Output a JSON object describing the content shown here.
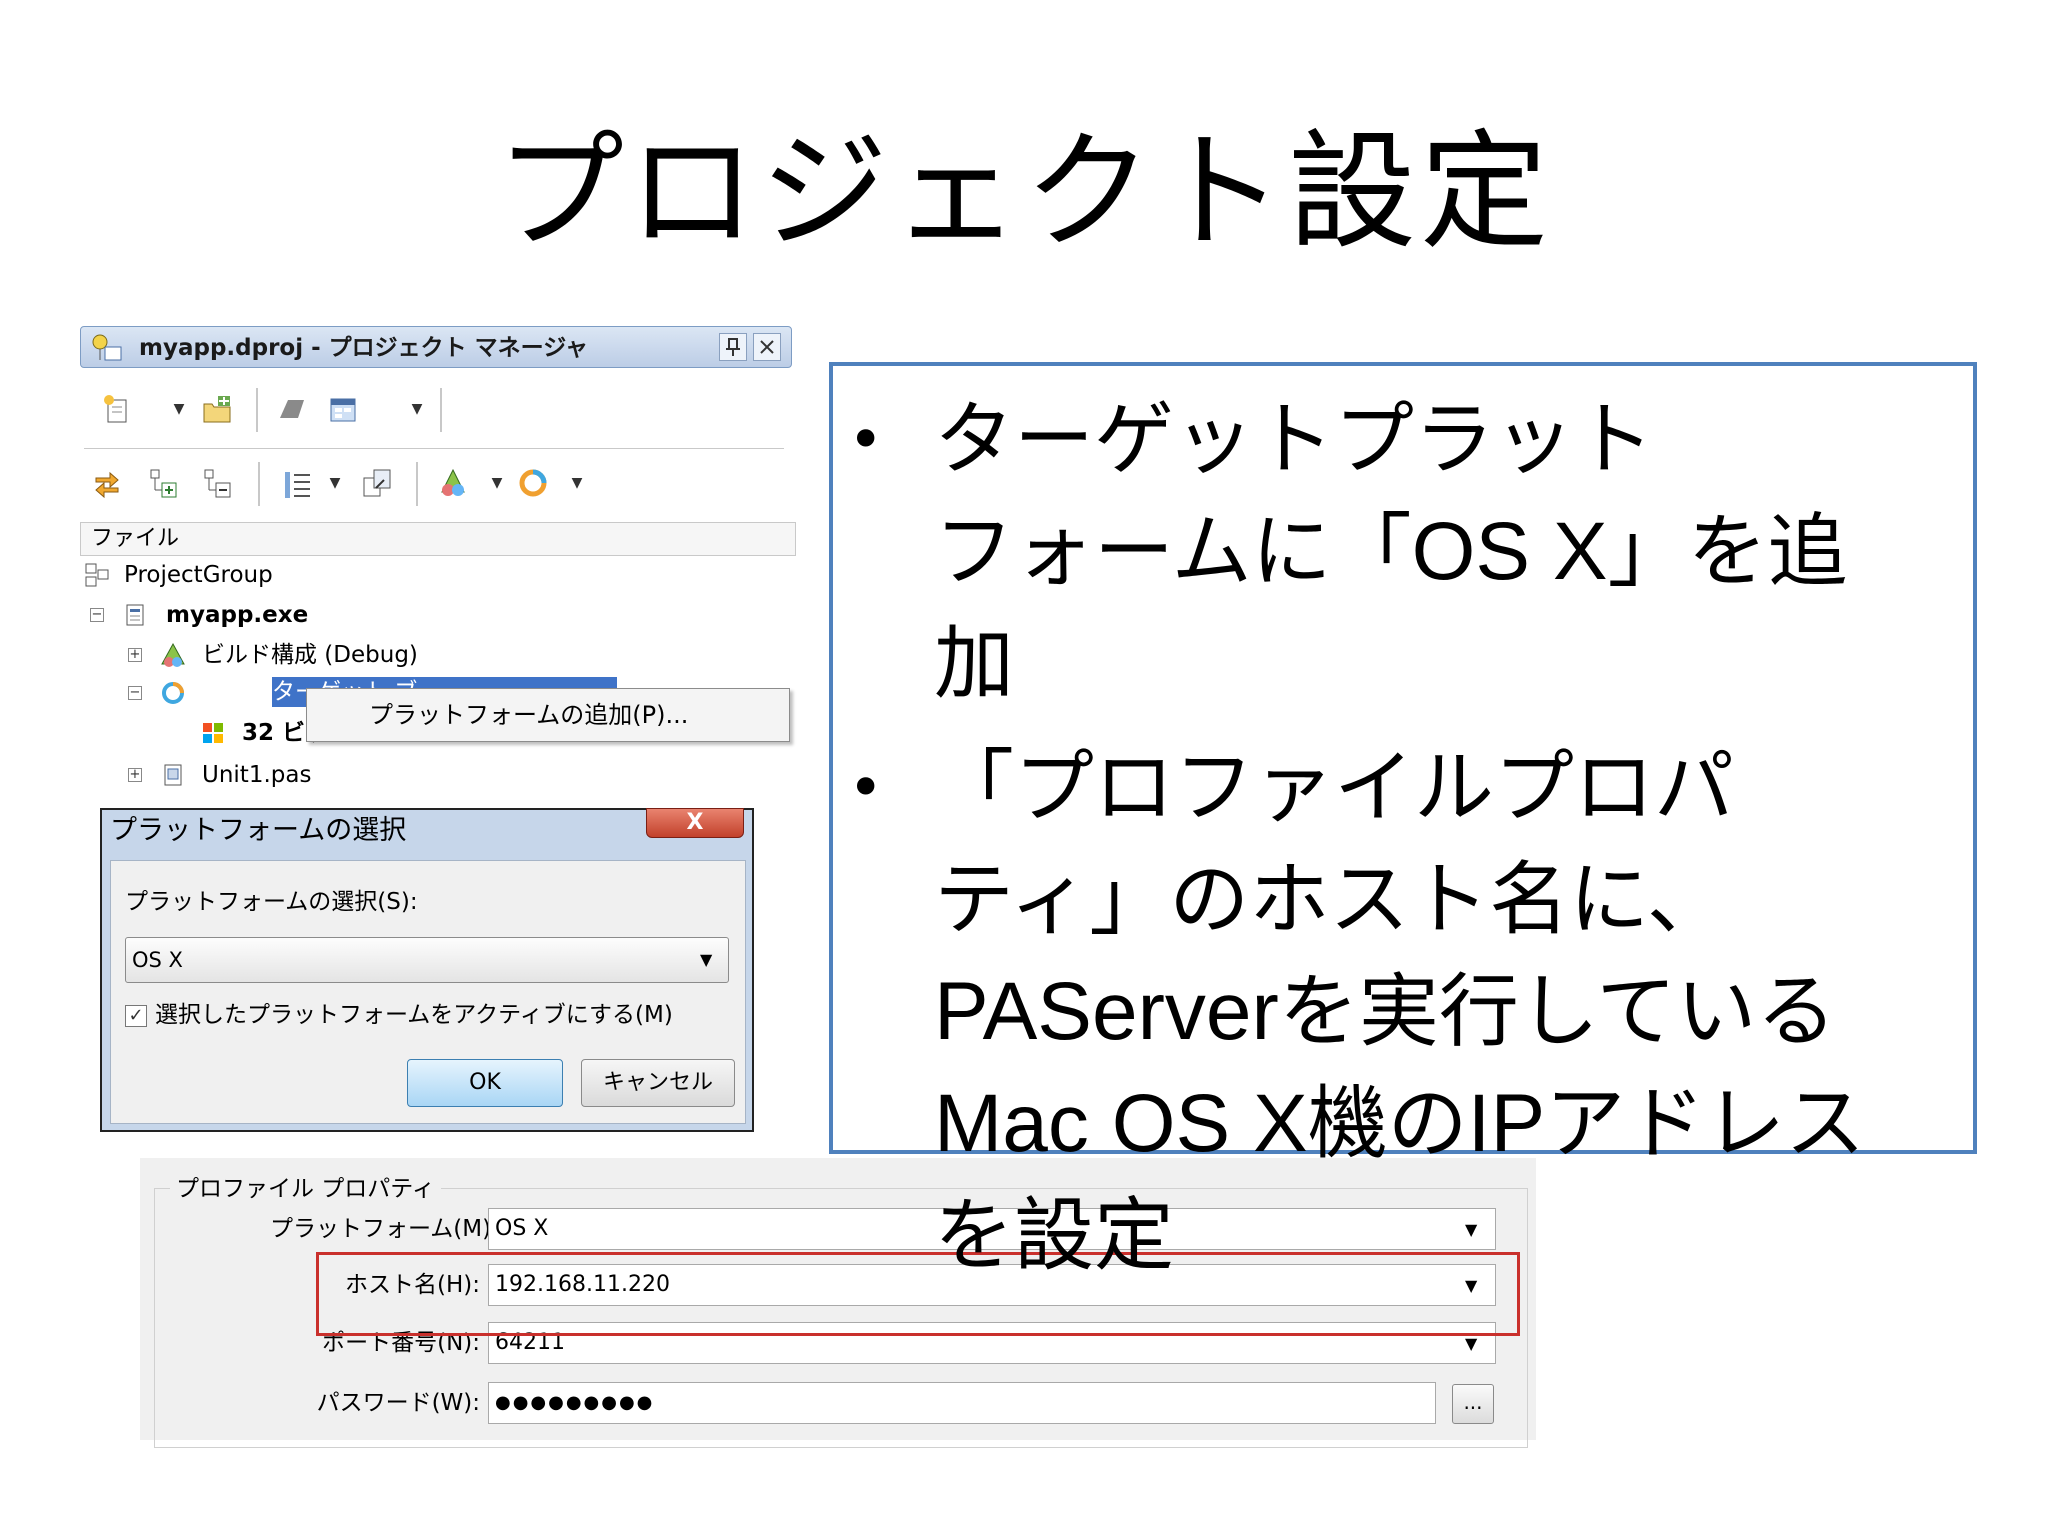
{
  "slide": {
    "title": "プロジェクト設定"
  },
  "project_manager": {
    "title": "myapp.dproj - プロジェクト マネージャ",
    "pin_button": "ㅁ",
    "close_button": "☒",
    "column_header": "ファイル",
    "tree": {
      "group": "ProjectGroup",
      "project": "myapp.exe",
      "build_config": "ビルド構成 (Debug)",
      "target_platforms_partial": "ターゲット ブ",
      "platform_32bit_partial": "32 ビッ",
      "unit": "Unit1.pas"
    },
    "context_menu": {
      "item": "プラットフォームの追加(P)..."
    },
    "icons": {
      "toolbar": [
        "new-project-icon",
        "dropdown-icon",
        "add-existing-icon",
        "build-icon",
        "layout-icon",
        "dropdown-icon",
        "sync-icon",
        "add-child-icon",
        "remove-child-icon",
        "list-icon",
        "dropdown-icon",
        "deploy-icon",
        "run-icon",
        "dropdown-icon",
        "target-icon",
        "dropdown-icon"
      ]
    }
  },
  "platform_dialog": {
    "title": "プラットフォームの選択",
    "close_label": "X",
    "select_label": "プラットフォームの選択(S):",
    "selected_platform": "OS X",
    "checkbox_label": "選択したプラットフォームをアクティブにする(M)",
    "checkbox_checked": true,
    "ok_label": "OK",
    "cancel_label": "キャンセル"
  },
  "profile_properties": {
    "group_title": "プロファイル プロパティ",
    "platform_label": "プラットフォーム(M):",
    "platform_value": "OS X",
    "host_label": "ホスト名(H):",
    "host_value": "192.168.11.220",
    "port_label": "ポート番号(N):",
    "port_value": "64211",
    "password_label": "パスワード(W):",
    "password_value": "●●●●●●●●●",
    "browse_label": "...",
    "highlight_color": "#c9302c"
  },
  "bullets": {
    "border_color": "#4f81bd",
    "b1_l1": "ターゲットプラット",
    "b1_l2a": "フォームに「",
    "b1_l2b": "OS X",
    "b1_l2c": "」を追",
    "b1_l3": "加",
    "b2_l1": "「プロファイルプロパ",
    "b2_l2": "ティ」のホスト名に、",
    "b2_l3a": "PAServer",
    "b2_l3b": "を実行している",
    "b2_l4a": "Mac OS X",
    "b2_l4b": "機の",
    "b2_l4c": "IP",
    "b2_l4d": "アドレス",
    "b2_l5": "を設定"
  }
}
